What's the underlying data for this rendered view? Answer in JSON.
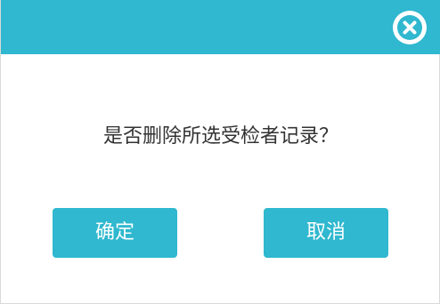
{
  "dialog": {
    "message": "是否删除所选受检者记录？",
    "confirm_label": "确定",
    "cancel_label": "取消",
    "close_icon": "close-icon"
  },
  "colors": {
    "accent": "#2fb8cf",
    "text": "#333333",
    "background": "#ffffff"
  }
}
